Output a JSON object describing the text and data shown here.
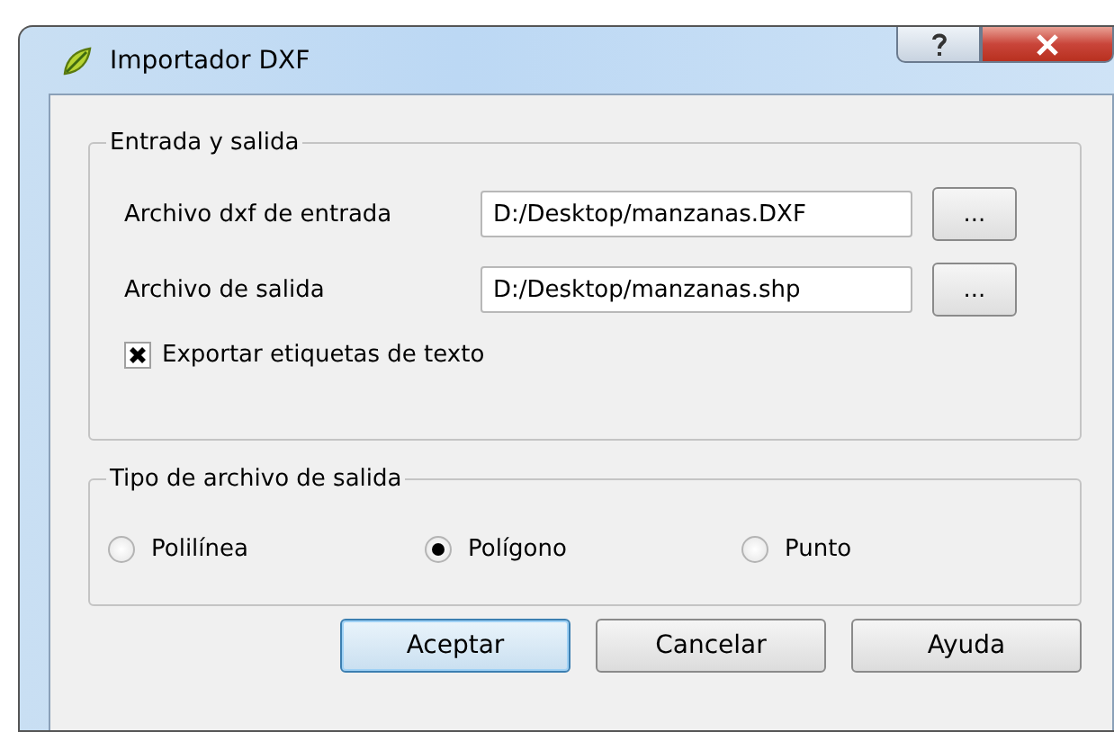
{
  "window": {
    "title": "Importador DXF"
  },
  "input_output": {
    "title": "Entrada y salida",
    "fields": [
      {
        "label": "Archivo dxf de entrada",
        "value": "D:/Desktop/manzanas.DXF",
        "browse": "..."
      },
      {
        "label": "Archivo de salida",
        "value": "D:/Desktop/manzanas.shp",
        "browse": "..."
      }
    ],
    "export_labels": {
      "label": "Exportar etiquetas de texto",
      "checked": true
    }
  },
  "output_type": {
    "title": "Tipo de archivo de salida",
    "options": [
      {
        "label": "Polilínea",
        "selected": false
      },
      {
        "label": "Polígono",
        "selected": true
      },
      {
        "label": "Punto",
        "selected": false
      }
    ]
  },
  "buttons": [
    {
      "label": "Aceptar",
      "default": true
    },
    {
      "label": "Cancelar",
      "default": false
    },
    {
      "label": "Ayuda",
      "default": false
    }
  ]
}
